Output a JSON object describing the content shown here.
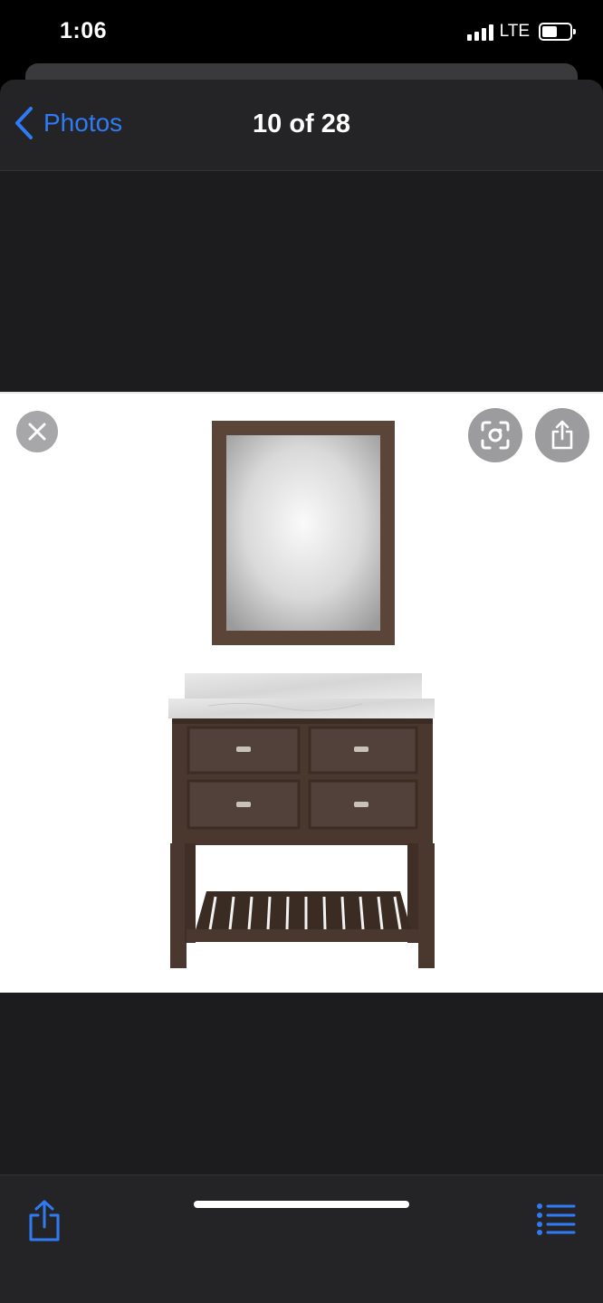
{
  "status_bar": {
    "time": "1:06",
    "network": "LTE",
    "signal_bars": 4,
    "battery_level": 0.55
  },
  "nav": {
    "back_label": "Photos",
    "title": "10 of 28"
  },
  "photo": {
    "subject": "bathroom-vanity-with-mirror"
  },
  "overlay_buttons": {
    "close_icon": "close-icon",
    "scan_icon": "visual-lookup-icon",
    "share_icon": "share-icon"
  },
  "toolbar": {
    "share_icon": "share-icon",
    "list_icon": "list-icon"
  },
  "colors": {
    "accent": "#2f7bf6",
    "sheet": "#1c1c1e",
    "bar": "#242426",
    "wood": "#4a372d"
  }
}
